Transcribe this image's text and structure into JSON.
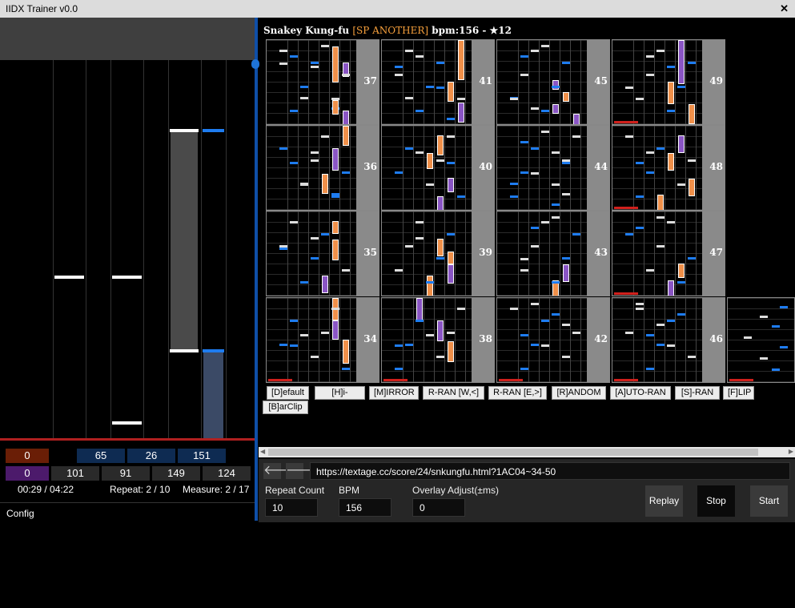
{
  "window": {
    "title": "IIDX Trainer v0.0",
    "close_glyph": "✕"
  },
  "song": {
    "title": "Snakey Kung-fu",
    "difficulty": "[SP ANOTHER]",
    "info": " bpm:156 - ★12"
  },
  "measures": [
    {
      "num": "37"
    },
    {
      "num": "41"
    },
    {
      "num": "45"
    },
    {
      "num": "49"
    },
    {
      "num": "36"
    },
    {
      "num": "40"
    },
    {
      "num": "44"
    },
    {
      "num": "48"
    },
    {
      "num": "35"
    },
    {
      "num": "39"
    },
    {
      "num": "43"
    },
    {
      "num": "47"
    },
    {
      "num": "34"
    },
    {
      "num": "38"
    },
    {
      "num": "42"
    },
    {
      "num": "46"
    }
  ],
  "options": [
    "[D]efault",
    "[H]i-Speed",
    "[M]IRROR",
    "R-RAN [W,<]",
    "R-RAN [E,>]",
    "[R]ANDOM",
    "[A]UTO-RAN",
    "[S]-RAN",
    "[F]LIP",
    "[B]arClip"
  ],
  "stats": {
    "row1": [
      "0",
      "65",
      "26",
      "151"
    ],
    "row2": [
      "0",
      "101",
      "91",
      "149",
      "124"
    ],
    "time": "00:29 / 04:22",
    "repeat": "Repeat: 2 / 10",
    "measure": "Measure: 2 / 17"
  },
  "config_label": "Config",
  "nav": {
    "back_glyph": "🡐",
    "forward_glyph": "🡒"
  },
  "url": "https://textage.cc/score/24/snkungfu.html?1AC04~34-50",
  "fields": {
    "repeat_count": {
      "label": "Repeat Count",
      "value": "10"
    },
    "bpm": {
      "label": "BPM",
      "value": "156"
    },
    "overlay": {
      "label": "Overlay Adjust(±ms)",
      "value": "0"
    }
  },
  "buttons": {
    "replay": "Replay",
    "stop": "Stop",
    "start": "Start"
  },
  "colors": {
    "accent_blue": "#0f4fa8",
    "hold_orange": "#f0904a",
    "hold_purple": "#8a55c4",
    "note_blue": "#1e7cf0",
    "scratch_red": "#d0201c",
    "diff_orange": "#f7a03c"
  }
}
